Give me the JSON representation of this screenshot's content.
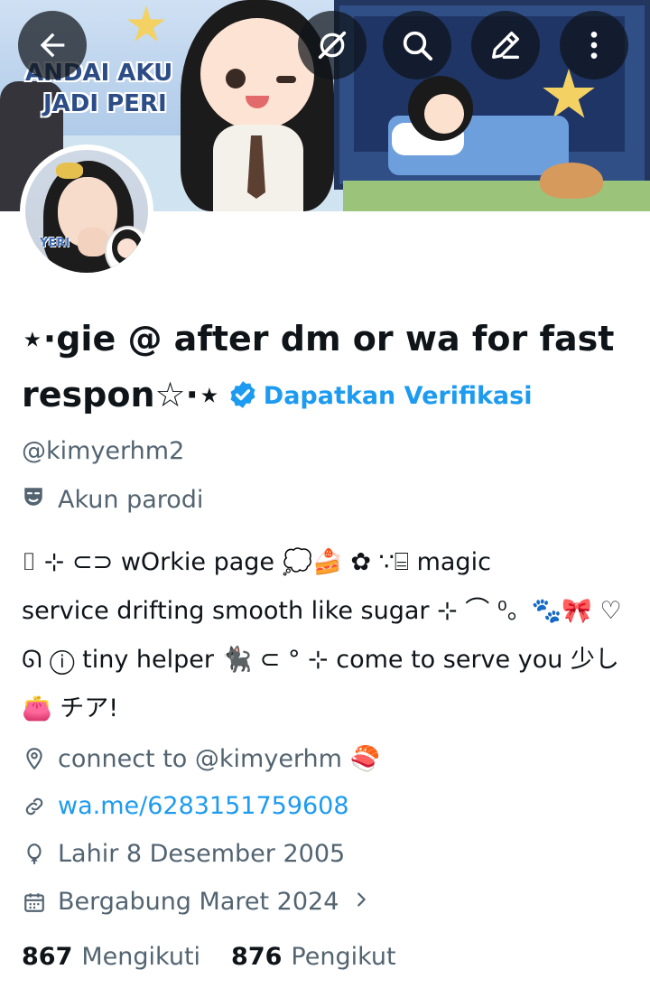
{
  "header": {
    "banner_title_line1": "ANDAI AKU",
    "banner_title_line2": "JADI PERI",
    "actions": [
      {
        "name": "back",
        "icon": "arrow-left-icon"
      },
      {
        "name": "grok",
        "icon": "grok-icon"
      },
      {
        "name": "search",
        "icon": "search-icon"
      },
      {
        "name": "edit",
        "icon": "pencil-icon"
      },
      {
        "name": "more",
        "icon": "more-vertical-icon"
      }
    ]
  },
  "avatar": {
    "label": "YERI"
  },
  "profile": {
    "name_line1": "⋆·gie @ after dm or wa for fast",
    "name_line2": "respon☆·⋆",
    "verified_icon": "verified-badge-icon",
    "verified_color": "#1d9bf0",
    "get_verified": "Dapatkan Verifikasi",
    "handle": "@kimyerhm2",
    "parody": "Akun parodi",
    "bio_lines": [
      "⌷ ⊹ ⊂⊃ wOrkie page 💭🍰 ✿ ∵⌸ magic",
      "service drifting smooth like sugar ⊹ ⌒ ⁰。🐾🎀 ♡",
      "ᘏ ⓘ tiny helper 🐈‍⬛ ⊂ ° ⊹ come to serve you 少し",
      "👛 チア!"
    ],
    "location": "connect to @kimyerhm 🍣",
    "website": "wa.me/6283151759608",
    "birthday": "Lahir 8 Desember 2005",
    "joined": "Bergabung Maret 2024"
  },
  "stats": {
    "following_count": "867",
    "following_label": "Mengikuti",
    "followers_count": "876",
    "followers_label": "Pengikut"
  },
  "colors": {
    "text_primary": "#0f1419",
    "text_secondary": "#536471",
    "accent": "#1d9bf0"
  }
}
